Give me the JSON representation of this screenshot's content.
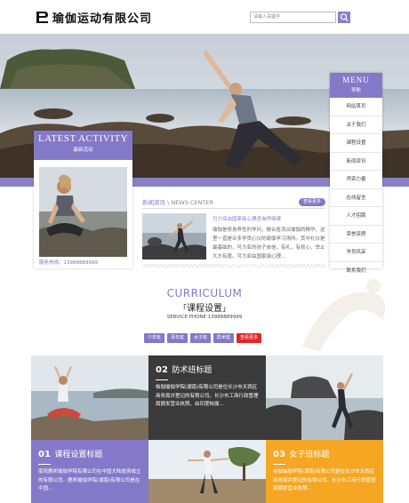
{
  "header": {
    "logo_text": "瑜伽运动有限公司",
    "search_placeholder": "请输入关键字"
  },
  "menu": {
    "title": "MENU",
    "subtitle": "导航",
    "items": [
      "网站首页",
      "关于我们",
      "课程设置",
      "新闻资讯",
      "师资力量",
      "在线留言",
      "人才招聘",
      "荣誉资质",
      "学员风采",
      "联系我们"
    ]
  },
  "activity": {
    "title": "LATEST ACTIVITY",
    "subtitle": "最新活动",
    "phone": "服务热线：13988889999"
  },
  "news": {
    "section_cn": "新闻资讯",
    "section_en": "\\ NEWS CENTER",
    "more": "查看更多",
    "headline": "可力亚由国家级心理咨询师授课",
    "body": "瑜伽是修身养性的学问，融合各流派瑜伽的精华，这里一直是众多学员心仪的瑜伽学习场所。其中礼仪是最基础的，可力亚的孩子自信，有礼，有修心，举止大方有度。可力亚由国家级心理..."
  },
  "curriculum": {
    "title_en": "CURRICULUM",
    "title_cn": "课程设置",
    "phone": "SERVICE PHONE 13988889999",
    "tags": [
      "少年班",
      "青年班",
      "女子班",
      "防术班",
      "查看更多"
    ]
  },
  "courses": [
    {
      "num": "01",
      "name": "课程设置标题",
      "text": "南阳鹿邦瑜伽学院有限公司在中国大陆投资成立的有限公司，鹿邦瑜伽学院(湖南)有限公司是在中国..."
    },
    {
      "num": "02",
      "name": "防术班标题",
      "text": "帕伽瑜伽学院(湖南)有限公司是位长沙市天西区商务局并登记的有限公司。长沙市工商行政管理局颁发营业执照，由印度帕伽..."
    },
    {
      "num": "03",
      "name": "女子班标题",
      "text": "帕伽瑜伽学院(湖南)有限公司是位长沙市天西区商务局并登记的有限公司，长沙市工商行政管理局颁发营业执照..."
    }
  ],
  "colors": {
    "accent": "#8479c9",
    "dark_cell": "#3a3a3a",
    "purple_cell": "#8479c9",
    "orange_cell": "#f5a623",
    "tag_red": "#e0262a"
  }
}
